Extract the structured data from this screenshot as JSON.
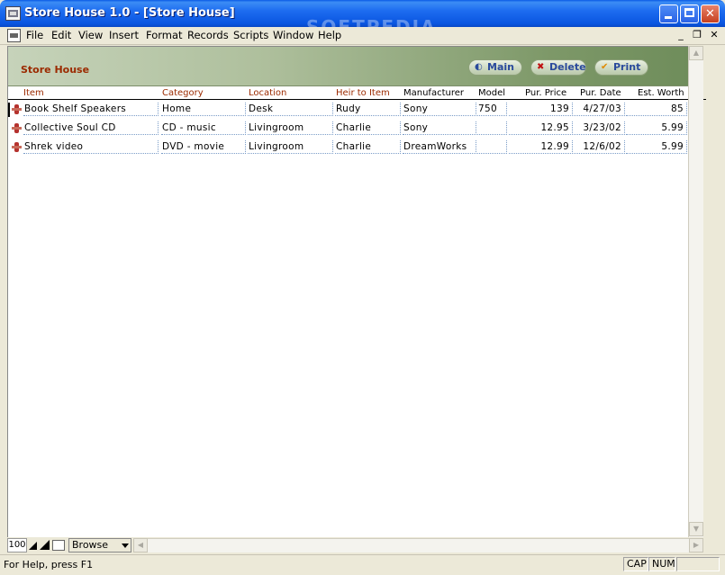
{
  "window": {
    "title": "Store House 1.0 - [Store House]",
    "watermark": "SOFTPEDIA"
  },
  "menu": {
    "items": [
      "File",
      "Edit",
      "View",
      "Insert",
      "Format",
      "Records",
      "Scripts",
      "Window",
      "Help"
    ]
  },
  "layout": {
    "title": "Store House",
    "buttons": {
      "main": "Main",
      "delete": "Delete",
      "print": "Print"
    }
  },
  "columns": [
    "Item",
    "Category",
    "Location",
    "Heir to Item",
    "Manufacturer",
    "Model",
    "Pur. Price",
    "Pur. Date",
    "Est. Worth"
  ],
  "records": [
    {
      "item": "Book Shelf Speakers",
      "category": "Home",
      "location": "Desk",
      "heir": "Rudy",
      "manufacturer": "Sony",
      "model": "750",
      "price": "139",
      "date": "4/27/03",
      "worth": "85"
    },
    {
      "item": "Collective Soul CD",
      "category": "CD - music",
      "location": "Livingroom",
      "heir": "Charlie",
      "manufacturer": "Sony",
      "model": "",
      "price": "12.95",
      "date": "3/23/02",
      "worth": "5.99"
    },
    {
      "item": "Shrek video",
      "category": "DVD - movie",
      "location": "Livingroom",
      "heir": "Charlie",
      "manufacturer": "DreamWorks",
      "model": "",
      "price": "12.99",
      "date": "12/6/02",
      "worth": "5.99"
    }
  ],
  "bottom_bar": {
    "zoom": "100",
    "mode": "Browse"
  },
  "status": {
    "help_text": "For Help, press F1",
    "cap": "CAP",
    "num": "NUM"
  },
  "colors": {
    "title_bar": "#0a55e0",
    "header_band": "#aebf9c",
    "accent_brown": "#9b2a00",
    "button_text": "#2a4a9c"
  }
}
